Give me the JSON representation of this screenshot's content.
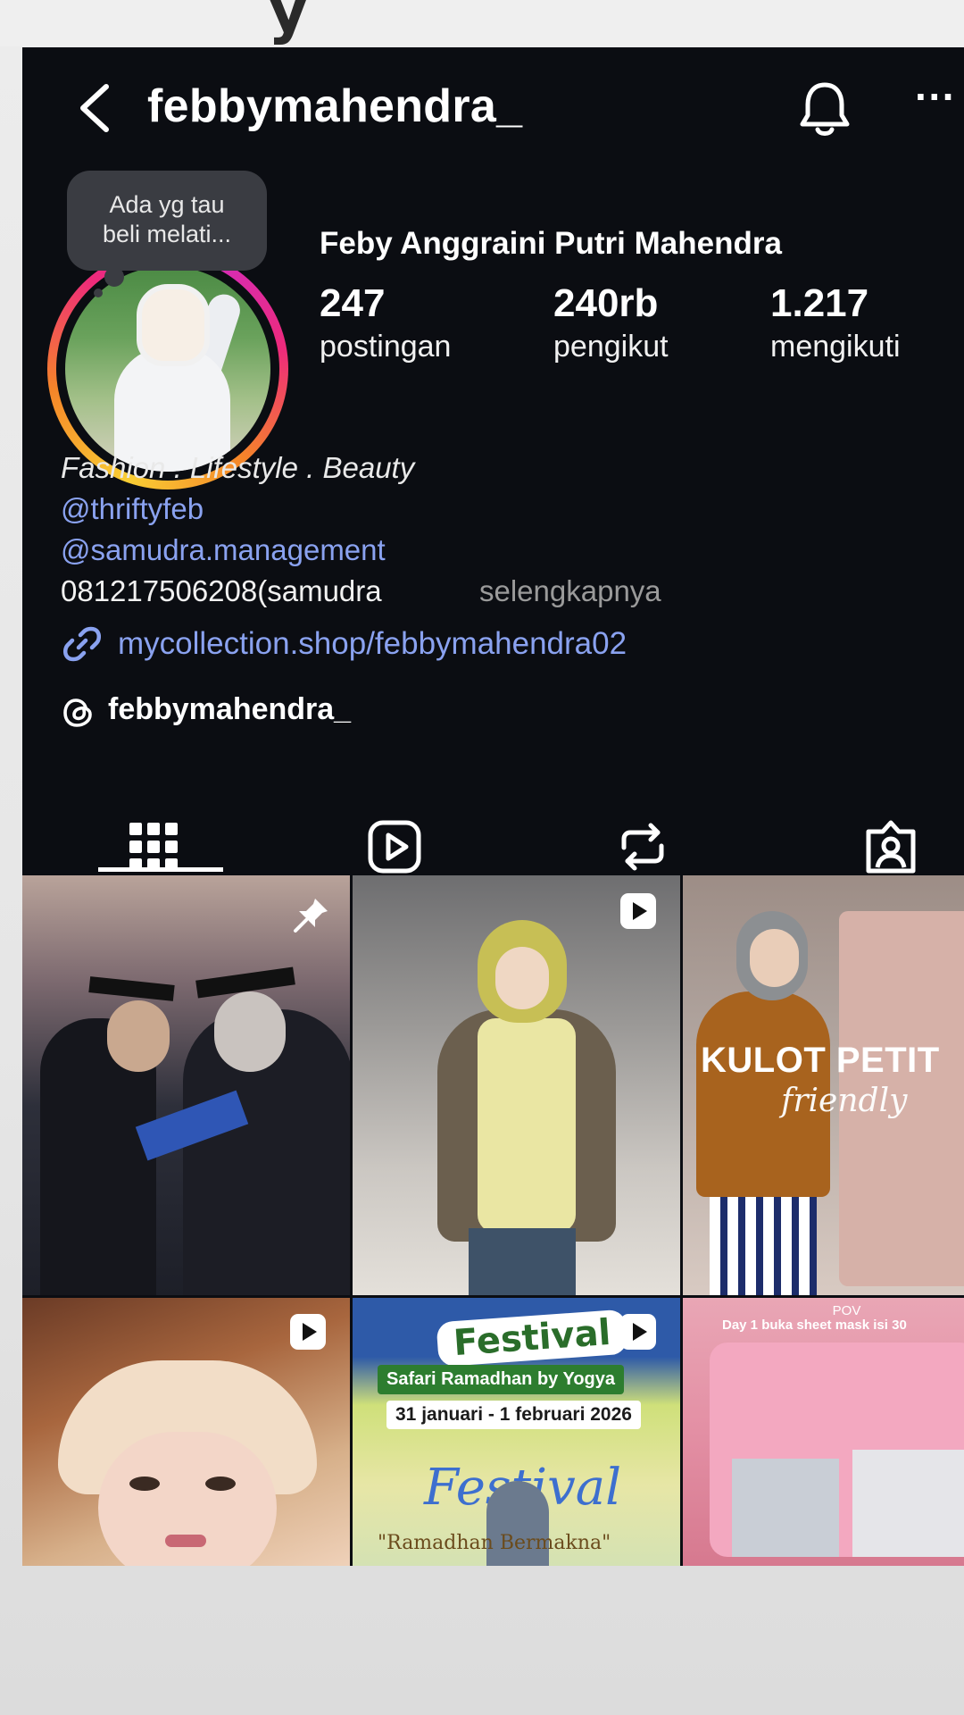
{
  "header": {
    "username": "febbymahendra_",
    "more_glyph": "···"
  },
  "profile": {
    "note_line1": "Ada yg tau",
    "note_line2": "beli melati...",
    "full_name": "Feby Anggraini Putri Mahendra",
    "stats": [
      {
        "value": "247",
        "label": "postingan"
      },
      {
        "value": "240rb",
        "label": "pengikut"
      },
      {
        "value": "1.217",
        "label": "mengikuti"
      }
    ],
    "bio": {
      "category": "Fashion . Lifestyle . Beauty",
      "mention1": "@thriftyfeb",
      "mention2": "@samudra.management",
      "phone": "081217506208(samudra",
      "more": "selengkapnya",
      "link": "mycollection.shop/febbymahendra02",
      "threads": "febbymahendra_"
    }
  },
  "tabs": [
    "posts-grid-icon",
    "reels-icon",
    "reposts-icon",
    "tagged-icon"
  ],
  "grid": {
    "post3_caption": "KULOT PETIT",
    "post3_script": "friendly",
    "post5_title": "Festival",
    "post5_subtitle": "Safari Ramadhan by Yogya",
    "post5_date": "31 januari - 1 februari 2026",
    "post5_script": "Festival",
    "post5_bottom": "\"Ramadhan         Bermakna\"",
    "post6_pov": "POV",
    "post6_caption": "Day 1 buka sheet mask isi 30"
  },
  "colors": {
    "background": "#0b0d12",
    "link": "#8aa2f0",
    "story_ring": [
      "#f9ce34",
      "#ee2a7b",
      "#d32dbd"
    ]
  }
}
